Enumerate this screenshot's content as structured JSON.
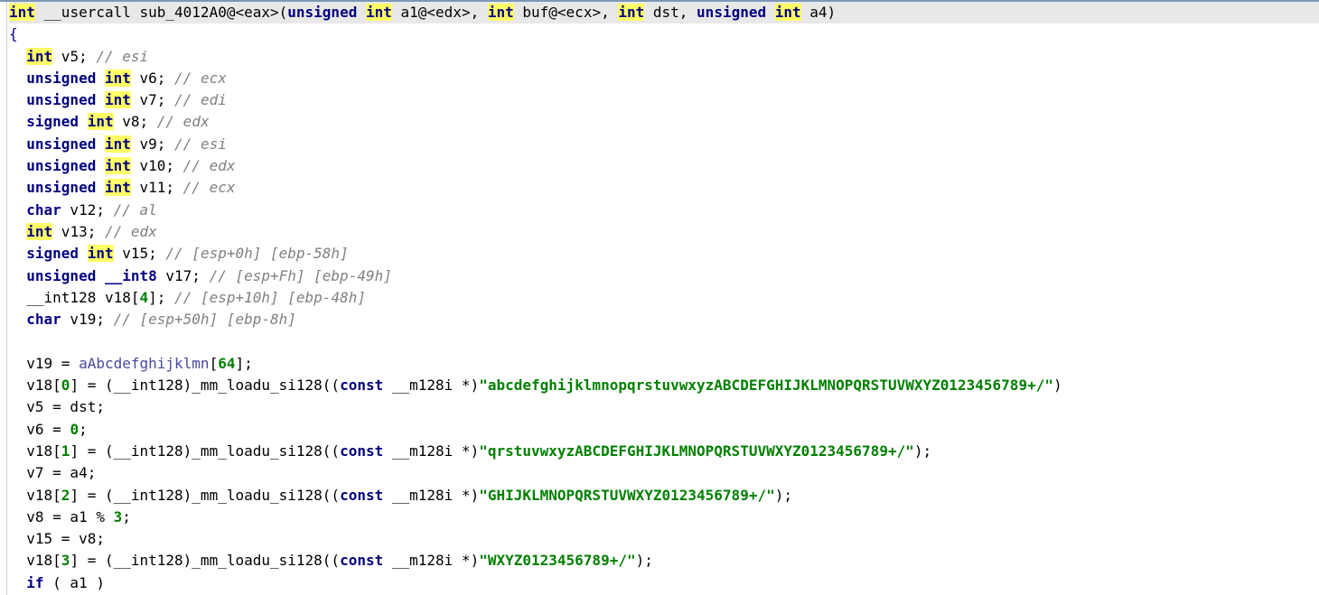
{
  "highlight_word": "int",
  "lines": [
    {
      "bg": "sig",
      "indent": 0,
      "tokens": [
        {
          "t": "hl",
          "v": "int"
        },
        {
          "t": "plain",
          "v": " __usercall sub_4012A0@<eax>("
        },
        {
          "t": "kw",
          "v": "unsigned"
        },
        {
          "t": "plain",
          "v": " "
        },
        {
          "t": "hl",
          "v": "int"
        },
        {
          "t": "plain",
          "v": " a1@<edx>, "
        },
        {
          "t": "hl",
          "v": "int"
        },
        {
          "t": "plain",
          "v": " buf@<ecx>, "
        },
        {
          "t": "hl",
          "v": "int"
        },
        {
          "t": "plain",
          "v": " dst, "
        },
        {
          "t": "kw",
          "v": "unsigned"
        },
        {
          "t": "plain",
          "v": " "
        },
        {
          "t": "hl",
          "v": "int"
        },
        {
          "t": "plain",
          "v": " a4)"
        }
      ]
    },
    {
      "indent": 0,
      "tokens": [
        {
          "t": "brace",
          "v": "{"
        }
      ]
    },
    {
      "indent": 1,
      "tokens": [
        {
          "t": "hl",
          "v": "int"
        },
        {
          "t": "plain",
          "v": " v5; "
        },
        {
          "t": "comment",
          "v": "// esi"
        }
      ]
    },
    {
      "indent": 1,
      "tokens": [
        {
          "t": "kw",
          "v": "unsigned"
        },
        {
          "t": "plain",
          "v": " "
        },
        {
          "t": "hl",
          "v": "int"
        },
        {
          "t": "plain",
          "v": " v6; "
        },
        {
          "t": "comment",
          "v": "// ecx"
        }
      ]
    },
    {
      "indent": 1,
      "tokens": [
        {
          "t": "kw",
          "v": "unsigned"
        },
        {
          "t": "plain",
          "v": " "
        },
        {
          "t": "hl",
          "v": "int"
        },
        {
          "t": "plain",
          "v": " v7; "
        },
        {
          "t": "comment",
          "v": "// edi"
        }
      ]
    },
    {
      "indent": 1,
      "tokens": [
        {
          "t": "kw",
          "v": "signed"
        },
        {
          "t": "plain",
          "v": " "
        },
        {
          "t": "hl",
          "v": "int"
        },
        {
          "t": "plain",
          "v": " v8; "
        },
        {
          "t": "comment",
          "v": "// edx"
        }
      ]
    },
    {
      "indent": 1,
      "tokens": [
        {
          "t": "kw",
          "v": "unsigned"
        },
        {
          "t": "plain",
          "v": " "
        },
        {
          "t": "hl",
          "v": "int"
        },
        {
          "t": "plain",
          "v": " v9; "
        },
        {
          "t": "comment",
          "v": "// esi"
        }
      ]
    },
    {
      "indent": 1,
      "tokens": [
        {
          "t": "kw",
          "v": "unsigned"
        },
        {
          "t": "plain",
          "v": " "
        },
        {
          "t": "hl",
          "v": "int"
        },
        {
          "t": "plain",
          "v": " v10; "
        },
        {
          "t": "comment",
          "v": "// edx"
        }
      ]
    },
    {
      "indent": 1,
      "tokens": [
        {
          "t": "kw",
          "v": "unsigned"
        },
        {
          "t": "plain",
          "v": " "
        },
        {
          "t": "hl",
          "v": "int"
        },
        {
          "t": "plain",
          "v": " v11; "
        },
        {
          "t": "comment",
          "v": "// ecx"
        }
      ]
    },
    {
      "indent": 1,
      "tokens": [
        {
          "t": "kw",
          "v": "char"
        },
        {
          "t": "plain",
          "v": " v12; "
        },
        {
          "t": "comment",
          "v": "// al"
        }
      ]
    },
    {
      "indent": 1,
      "tokens": [
        {
          "t": "hl",
          "v": "int"
        },
        {
          "t": "plain",
          "v": " v13; "
        },
        {
          "t": "comment",
          "v": "// edx"
        }
      ]
    },
    {
      "indent": 1,
      "tokens": [
        {
          "t": "kw",
          "v": "signed"
        },
        {
          "t": "plain",
          "v": " "
        },
        {
          "t": "hl",
          "v": "int"
        },
        {
          "t": "plain",
          "v": " v15; "
        },
        {
          "t": "comment",
          "v": "// [esp+0h] [ebp-58h]"
        }
      ]
    },
    {
      "indent": 1,
      "tokens": [
        {
          "t": "kw",
          "v": "unsigned"
        },
        {
          "t": "plain",
          "v": " "
        },
        {
          "t": "kw",
          "v": "__int8"
        },
        {
          "t": "plain",
          "v": " v17; "
        },
        {
          "t": "comment",
          "v": "// [esp+Fh] [ebp-49h]"
        }
      ]
    },
    {
      "indent": 1,
      "tokens": [
        {
          "t": "plain",
          "v": "__int128 v18["
        },
        {
          "t": "num",
          "v": "4"
        },
        {
          "t": "plain",
          "v": "]; "
        },
        {
          "t": "comment",
          "v": "// [esp+10h] [ebp-48h]"
        }
      ]
    },
    {
      "indent": 1,
      "tokens": [
        {
          "t": "kw",
          "v": "char"
        },
        {
          "t": "plain",
          "v": " v19; "
        },
        {
          "t": "comment",
          "v": "// [esp+50h] [ebp-8h]"
        }
      ]
    },
    {
      "indent": 0,
      "tokens": []
    },
    {
      "indent": 1,
      "tokens": [
        {
          "t": "plain",
          "v": "v19 = "
        },
        {
          "t": "var",
          "v": "aAbcdefghijklmn"
        },
        {
          "t": "plain",
          "v": "["
        },
        {
          "t": "num",
          "v": "64"
        },
        {
          "t": "plain",
          "v": "];"
        }
      ]
    },
    {
      "indent": 1,
      "tokens": [
        {
          "t": "plain",
          "v": "v18["
        },
        {
          "t": "num",
          "v": "0"
        },
        {
          "t": "plain",
          "v": "] = (__int128)_mm_loadu_si128(("
        },
        {
          "t": "kw",
          "v": "const"
        },
        {
          "t": "plain",
          "v": " __m128i *)"
        },
        {
          "t": "str",
          "v": "\"abcdefghijklmnopqrstuvwxyzABCDEFGHIJKLMNOPQRSTUVWXYZ0123456789+/\""
        },
        {
          "t": "plain",
          "v": ")"
        }
      ]
    },
    {
      "indent": 1,
      "tokens": [
        {
          "t": "plain",
          "v": "v5 = dst;"
        }
      ]
    },
    {
      "indent": 1,
      "tokens": [
        {
          "t": "plain",
          "v": "v6 = "
        },
        {
          "t": "num",
          "v": "0"
        },
        {
          "t": "plain",
          "v": ";"
        }
      ]
    },
    {
      "indent": 1,
      "tokens": [
        {
          "t": "plain",
          "v": "v18["
        },
        {
          "t": "num",
          "v": "1"
        },
        {
          "t": "plain",
          "v": "] = (__int128)_mm_loadu_si128(("
        },
        {
          "t": "kw",
          "v": "const"
        },
        {
          "t": "plain",
          "v": " __m128i *)"
        },
        {
          "t": "str",
          "v": "\"qrstuvwxyzABCDEFGHIJKLMNOPQRSTUVWXYZ0123456789+/\""
        },
        {
          "t": "plain",
          "v": ");"
        }
      ]
    },
    {
      "indent": 1,
      "tokens": [
        {
          "t": "plain",
          "v": "v7 = a4;"
        }
      ]
    },
    {
      "indent": 1,
      "tokens": [
        {
          "t": "plain",
          "v": "v18["
        },
        {
          "t": "num",
          "v": "2"
        },
        {
          "t": "plain",
          "v": "] = (__int128)_mm_loadu_si128(("
        },
        {
          "t": "kw",
          "v": "const"
        },
        {
          "t": "plain",
          "v": " __m128i *)"
        },
        {
          "t": "str",
          "v": "\"GHIJKLMNOPQRSTUVWXYZ0123456789+/\""
        },
        {
          "t": "plain",
          "v": ");"
        }
      ]
    },
    {
      "indent": 1,
      "tokens": [
        {
          "t": "plain",
          "v": "v8 = a1 % "
        },
        {
          "t": "num",
          "v": "3"
        },
        {
          "t": "plain",
          "v": ";"
        }
      ]
    },
    {
      "indent": 1,
      "tokens": [
        {
          "t": "plain",
          "v": "v15 = v8;"
        }
      ]
    },
    {
      "indent": 1,
      "tokens": [
        {
          "t": "plain",
          "v": "v18["
        },
        {
          "t": "num",
          "v": "3"
        },
        {
          "t": "plain",
          "v": "] = (__int128)_mm_loadu_si128(("
        },
        {
          "t": "kw",
          "v": "const"
        },
        {
          "t": "plain",
          "v": " __m128i *)"
        },
        {
          "t": "str",
          "v": "\"WXYZ0123456789+/\""
        },
        {
          "t": "plain",
          "v": ");"
        }
      ]
    },
    {
      "indent": 1,
      "tokens": [
        {
          "t": "kw",
          "v": "if"
        },
        {
          "t": "plain",
          "v": " ( a1 )"
        }
      ]
    }
  ]
}
